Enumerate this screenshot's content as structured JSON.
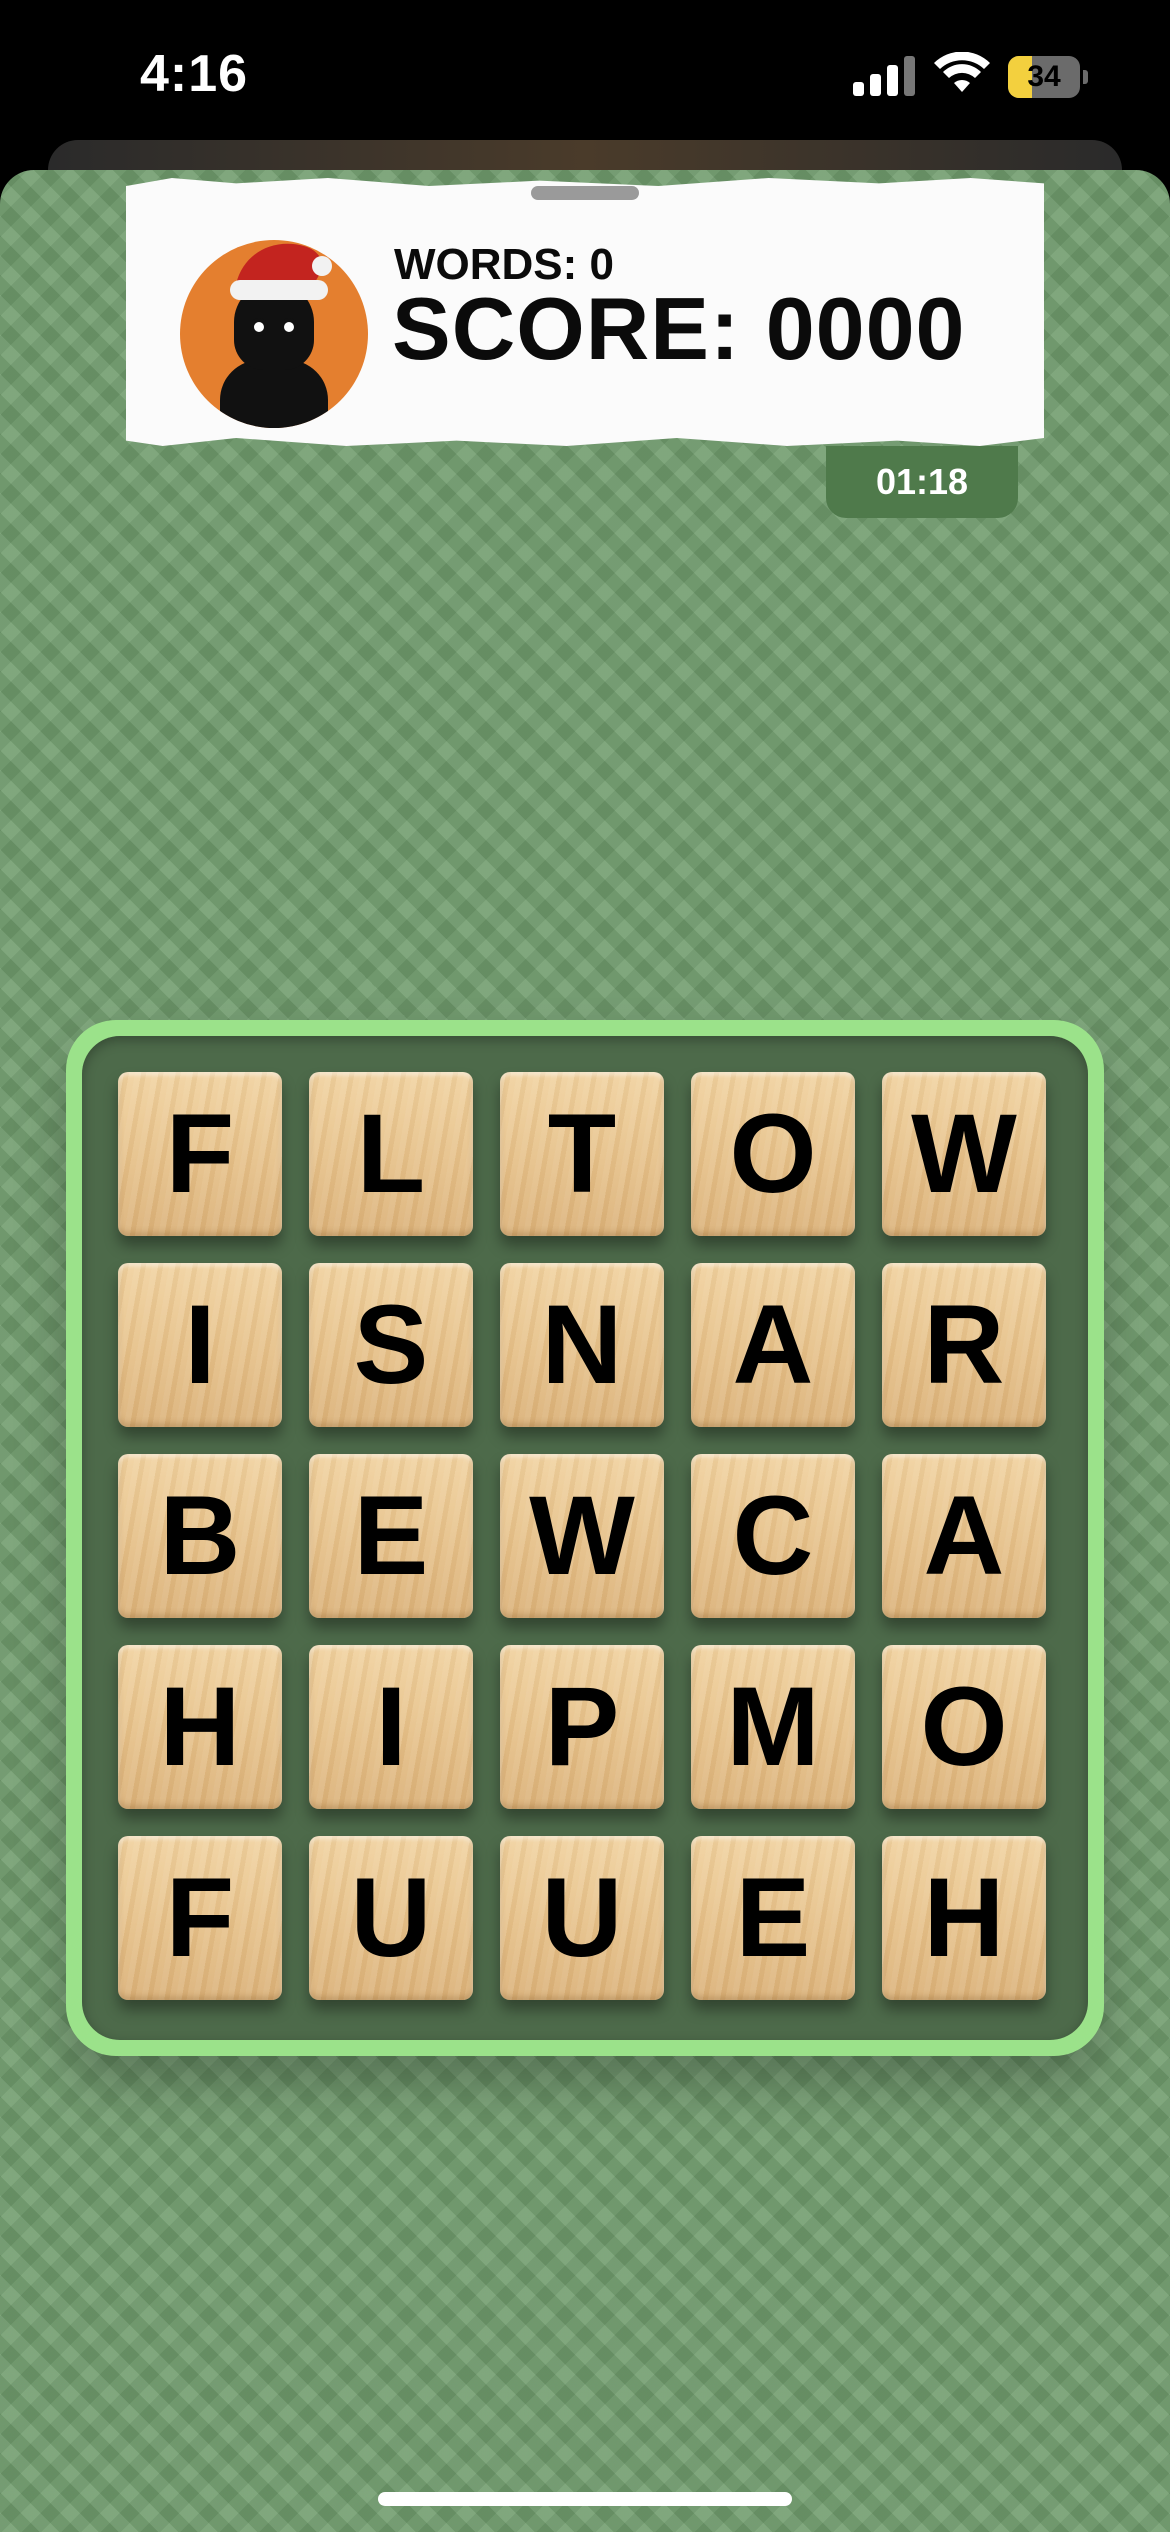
{
  "status_bar": {
    "time": "4:16",
    "battery": "34",
    "battery_level": 0.34,
    "icons": [
      "cellular-signal-icon",
      "wifi-icon",
      "battery-icon"
    ]
  },
  "scoreboard": {
    "words": "WORDS: 0",
    "score": "SCORE: 0000",
    "avatar": "player-avatar-santa-hat-icon"
  },
  "timer": "01:18",
  "board": {
    "rows": [
      [
        "F",
        "L",
        "T",
        "O",
        "W"
      ],
      [
        "I",
        "S",
        "N",
        "A",
        "R"
      ],
      [
        "B",
        "E",
        "W",
        "C",
        "A"
      ],
      [
        "H",
        "I",
        "P",
        "M",
        "O"
      ],
      [
        "F",
        "U",
        "U",
        "E",
        "H"
      ]
    ]
  },
  "colors": {
    "background": "#6f9b6c",
    "board_frame": "#9be28a",
    "board_inner": "#4d6a4a",
    "timer": "#4f7a4b",
    "avatar": "#e47f2f"
  }
}
